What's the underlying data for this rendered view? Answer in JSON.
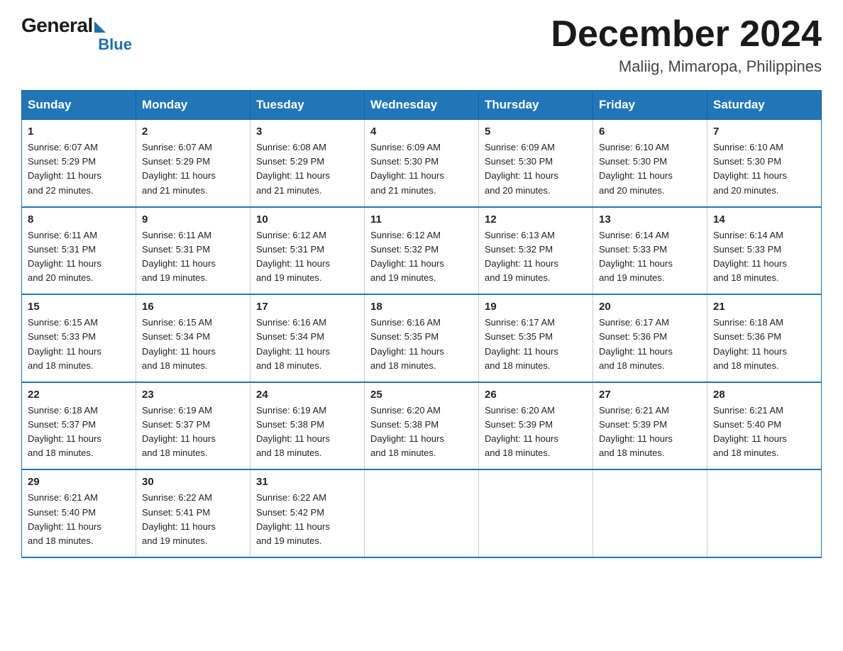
{
  "logo": {
    "general": "General",
    "blue": "Blue"
  },
  "header": {
    "month_year": "December 2024",
    "location": "Maliig, Mimaropa, Philippines"
  },
  "days_of_week": [
    "Sunday",
    "Monday",
    "Tuesday",
    "Wednesday",
    "Thursday",
    "Friday",
    "Saturday"
  ],
  "weeks": [
    [
      {
        "day": "1",
        "sunrise": "6:07 AM",
        "sunset": "5:29 PM",
        "daylight": "11 hours and 22 minutes."
      },
      {
        "day": "2",
        "sunrise": "6:07 AM",
        "sunset": "5:29 PM",
        "daylight": "11 hours and 21 minutes."
      },
      {
        "day": "3",
        "sunrise": "6:08 AM",
        "sunset": "5:29 PM",
        "daylight": "11 hours and 21 minutes."
      },
      {
        "day": "4",
        "sunrise": "6:09 AM",
        "sunset": "5:30 PM",
        "daylight": "11 hours and 21 minutes."
      },
      {
        "day": "5",
        "sunrise": "6:09 AM",
        "sunset": "5:30 PM",
        "daylight": "11 hours and 20 minutes."
      },
      {
        "day": "6",
        "sunrise": "6:10 AM",
        "sunset": "5:30 PM",
        "daylight": "11 hours and 20 minutes."
      },
      {
        "day": "7",
        "sunrise": "6:10 AM",
        "sunset": "5:30 PM",
        "daylight": "11 hours and 20 minutes."
      }
    ],
    [
      {
        "day": "8",
        "sunrise": "6:11 AM",
        "sunset": "5:31 PM",
        "daylight": "11 hours and 20 minutes."
      },
      {
        "day": "9",
        "sunrise": "6:11 AM",
        "sunset": "5:31 PM",
        "daylight": "11 hours and 19 minutes."
      },
      {
        "day": "10",
        "sunrise": "6:12 AM",
        "sunset": "5:31 PM",
        "daylight": "11 hours and 19 minutes."
      },
      {
        "day": "11",
        "sunrise": "6:12 AM",
        "sunset": "5:32 PM",
        "daylight": "11 hours and 19 minutes."
      },
      {
        "day": "12",
        "sunrise": "6:13 AM",
        "sunset": "5:32 PM",
        "daylight": "11 hours and 19 minutes."
      },
      {
        "day": "13",
        "sunrise": "6:14 AM",
        "sunset": "5:33 PM",
        "daylight": "11 hours and 19 minutes."
      },
      {
        "day": "14",
        "sunrise": "6:14 AM",
        "sunset": "5:33 PM",
        "daylight": "11 hours and 18 minutes."
      }
    ],
    [
      {
        "day": "15",
        "sunrise": "6:15 AM",
        "sunset": "5:33 PM",
        "daylight": "11 hours and 18 minutes."
      },
      {
        "day": "16",
        "sunrise": "6:15 AM",
        "sunset": "5:34 PM",
        "daylight": "11 hours and 18 minutes."
      },
      {
        "day": "17",
        "sunrise": "6:16 AM",
        "sunset": "5:34 PM",
        "daylight": "11 hours and 18 minutes."
      },
      {
        "day": "18",
        "sunrise": "6:16 AM",
        "sunset": "5:35 PM",
        "daylight": "11 hours and 18 minutes."
      },
      {
        "day": "19",
        "sunrise": "6:17 AM",
        "sunset": "5:35 PM",
        "daylight": "11 hours and 18 minutes."
      },
      {
        "day": "20",
        "sunrise": "6:17 AM",
        "sunset": "5:36 PM",
        "daylight": "11 hours and 18 minutes."
      },
      {
        "day": "21",
        "sunrise": "6:18 AM",
        "sunset": "5:36 PM",
        "daylight": "11 hours and 18 minutes."
      }
    ],
    [
      {
        "day": "22",
        "sunrise": "6:18 AM",
        "sunset": "5:37 PM",
        "daylight": "11 hours and 18 minutes."
      },
      {
        "day": "23",
        "sunrise": "6:19 AM",
        "sunset": "5:37 PM",
        "daylight": "11 hours and 18 minutes."
      },
      {
        "day": "24",
        "sunrise": "6:19 AM",
        "sunset": "5:38 PM",
        "daylight": "11 hours and 18 minutes."
      },
      {
        "day": "25",
        "sunrise": "6:20 AM",
        "sunset": "5:38 PM",
        "daylight": "11 hours and 18 minutes."
      },
      {
        "day": "26",
        "sunrise": "6:20 AM",
        "sunset": "5:39 PM",
        "daylight": "11 hours and 18 minutes."
      },
      {
        "day": "27",
        "sunrise": "6:21 AM",
        "sunset": "5:39 PM",
        "daylight": "11 hours and 18 minutes."
      },
      {
        "day": "28",
        "sunrise": "6:21 AM",
        "sunset": "5:40 PM",
        "daylight": "11 hours and 18 minutes."
      }
    ],
    [
      {
        "day": "29",
        "sunrise": "6:21 AM",
        "sunset": "5:40 PM",
        "daylight": "11 hours and 18 minutes."
      },
      {
        "day": "30",
        "sunrise": "6:22 AM",
        "sunset": "5:41 PM",
        "daylight": "11 hours and 19 minutes."
      },
      {
        "day": "31",
        "sunrise": "6:22 AM",
        "sunset": "5:42 PM",
        "daylight": "11 hours and 19 minutes."
      },
      null,
      null,
      null,
      null
    ]
  ],
  "labels": {
    "sunrise": "Sunrise:",
    "sunset": "Sunset:",
    "daylight": "Daylight:"
  }
}
